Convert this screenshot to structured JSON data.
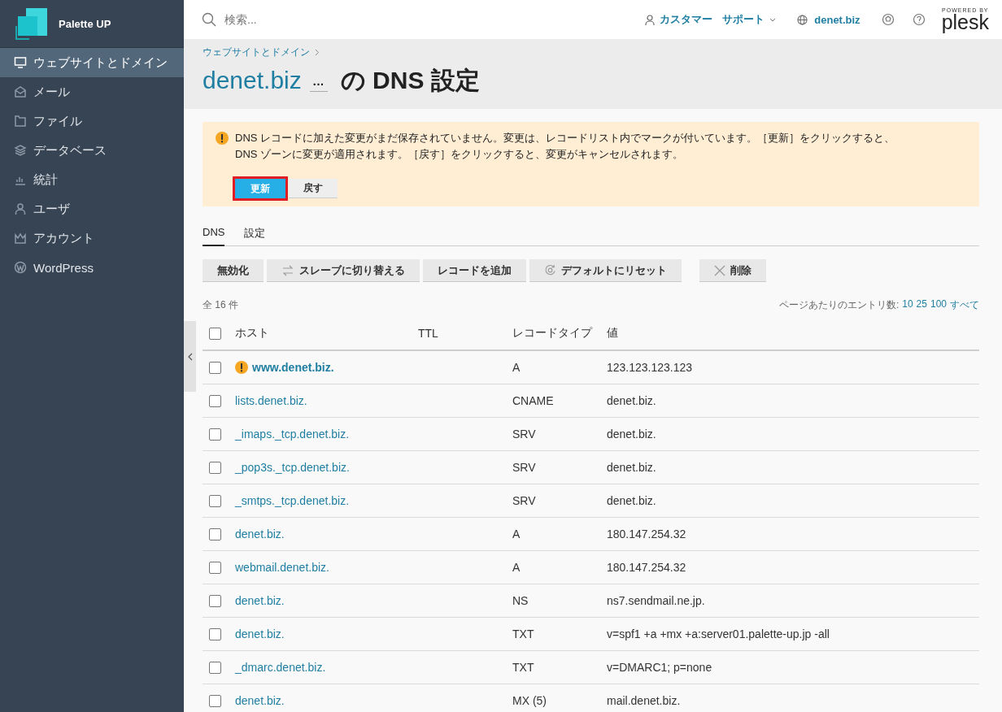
{
  "sidebar": {
    "brand": "Palette UP",
    "items": [
      {
        "label": "ウェブサイトとドメイン",
        "selected": true
      },
      {
        "label": "メール",
        "selected": false
      },
      {
        "label": "ファイル",
        "selected": false
      },
      {
        "label": "データベース",
        "selected": false
      },
      {
        "label": "統計",
        "selected": false
      },
      {
        "label": "ユーザ",
        "selected": false
      },
      {
        "label": "アカウント",
        "selected": false
      },
      {
        "label": "WordPress",
        "selected": false
      }
    ]
  },
  "header": {
    "search": {
      "placeholder": "検索..."
    },
    "customer": "カスタマー",
    "support": "サポート",
    "domain": "denet.biz",
    "powered_by": "POWERED BY",
    "plesk": "plesk"
  },
  "breadcrumb": [
    "ウェブサイトとドメイン"
  ],
  "title": {
    "domain": "denet.biz",
    "more": "···",
    "rest": "の DNS 設定"
  },
  "alert": {
    "text": "DNS レコードに加えた変更がまだ保存されていません。変更は、レコードリスト内でマークが付いています。［更新］をクリックすると、DNS ゾーンに変更が適用されます。［戻す］をクリックすると、変更がキャンセルされます。",
    "buttons": [
      {
        "label": "更新",
        "kind": "primary"
      },
      {
        "label": "戻す",
        "kind": "plain"
      }
    ]
  },
  "tabs": [
    {
      "label": "DNS",
      "selected": true
    },
    {
      "label": "設定",
      "selected": false
    }
  ],
  "toolbar": [
    "無効化",
    "スレーブに切り替える",
    "レコードを追加",
    "デフォルトにリセット",
    "削除"
  ],
  "total": "全 16 件",
  "per_page": {
    "label": "ページあたりのエントリ数:",
    "options": [
      "10",
      "25",
      "100",
      "すべて"
    ]
  },
  "table": {
    "select_all_checked": false,
    "columns": [
      "ホスト",
      "TTL",
      "レコードタイプ",
      "値"
    ],
    "rows": [
      {
        "host": "www.denet.biz.",
        "type": "A",
        "value": "123.123.123.123",
        "modified": true,
        "checked": false
      },
      {
        "host": "lists.denet.biz.",
        "type": "CNAME",
        "value": "denet.biz.",
        "modified": false,
        "checked": false
      },
      {
        "host": "_imaps._tcp.denet.biz.",
        "type": "SRV",
        "value": "denet.biz.",
        "modified": false,
        "checked": false
      },
      {
        "host": "_pop3s._tcp.denet.biz.",
        "type": "SRV",
        "value": "denet.biz.",
        "modified": false,
        "checked": false
      },
      {
        "host": "_smtps._tcp.denet.biz.",
        "type": "SRV",
        "value": "denet.biz.",
        "modified": false,
        "checked": false
      },
      {
        "host": "denet.biz.",
        "type": "A",
        "value": "180.147.254.32",
        "modified": false,
        "checked": false
      },
      {
        "host": "webmail.denet.biz.",
        "type": "A",
        "value": "180.147.254.32",
        "modified": false,
        "checked": false
      },
      {
        "host": "denet.biz.",
        "type": "NS",
        "value": "ns7.sendmail.ne.jp.",
        "modified": false,
        "checked": false
      },
      {
        "host": "denet.biz.",
        "type": "TXT",
        "value": "v=spf1 +a +mx +a:server01.palette-up.jp -all",
        "modified": false,
        "checked": false
      },
      {
        "host": "_dmarc.denet.biz.",
        "type": "TXT",
        "value": "v=DMARC1; p=none",
        "modified": false,
        "checked": false
      },
      {
        "host": "denet.biz.",
        "type": "MX (5)",
        "value": "mail.denet.biz.",
        "modified": false,
        "checked": false
      }
    ]
  }
}
